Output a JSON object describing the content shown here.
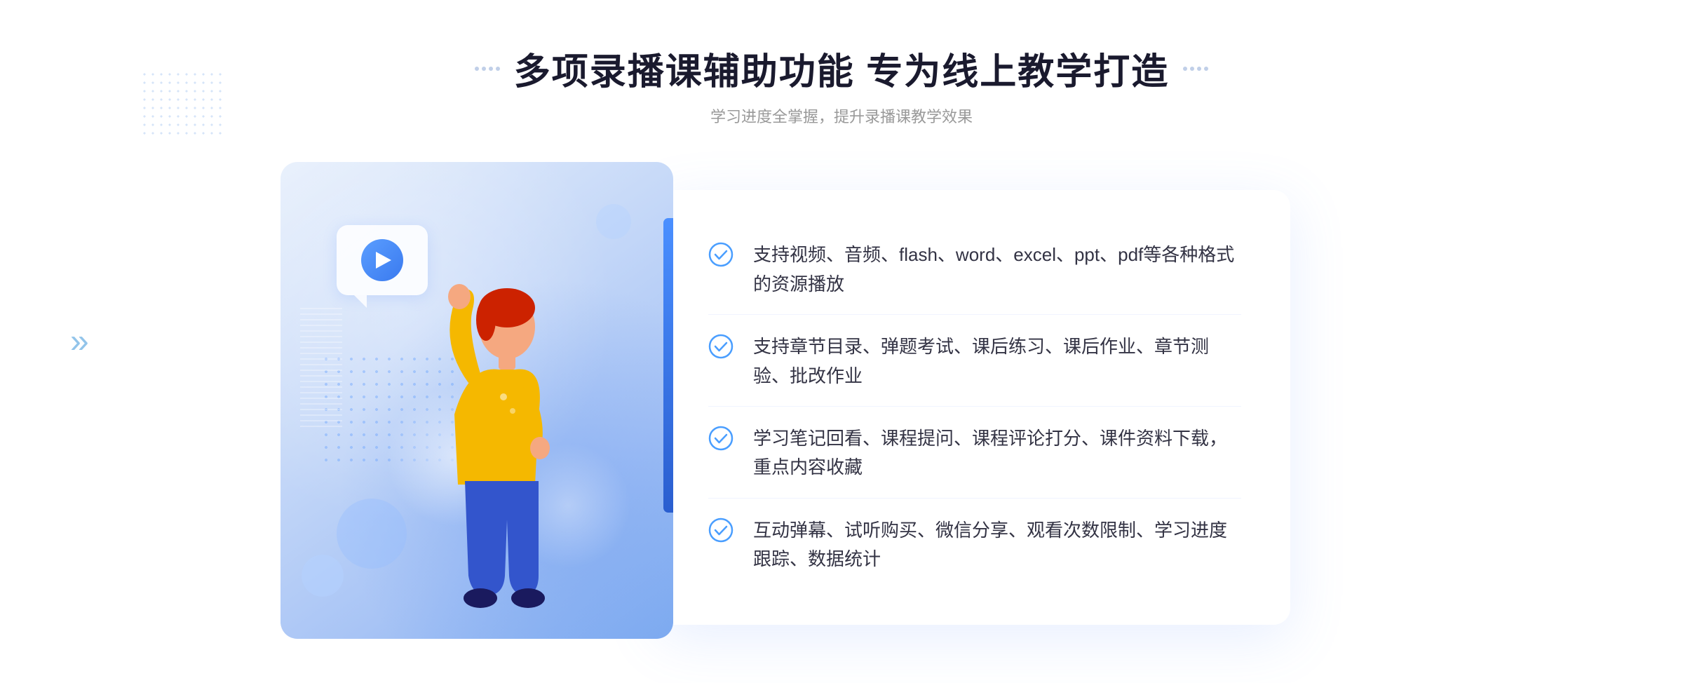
{
  "header": {
    "main_title": "多项录播课辅助功能 专为线上教学打造",
    "sub_title": "学习进度全掌握，提升录播课教学效果"
  },
  "features": [
    {
      "id": "feature-1",
      "text": "支持视频、音频、flash、word、excel、ppt、pdf等各种格式的资源播放"
    },
    {
      "id": "feature-2",
      "text": "支持章节目录、弹题考试、课后练习、课后作业、章节测验、批改作业"
    },
    {
      "id": "feature-3",
      "text": "学习笔记回看、课程提问、课程评论打分、课件资料下载，重点内容收藏"
    },
    {
      "id": "feature-4",
      "text": "互动弹幕、试听购买、微信分享、观看次数限制、学习进度跟踪、数据统计"
    }
  ],
  "colors": {
    "accent_blue": "#4a8fff",
    "title_color": "#1a1a2e",
    "text_color": "#333344",
    "subtitle_color": "#999999"
  },
  "decorations": {
    "chevron_symbol": "»"
  }
}
